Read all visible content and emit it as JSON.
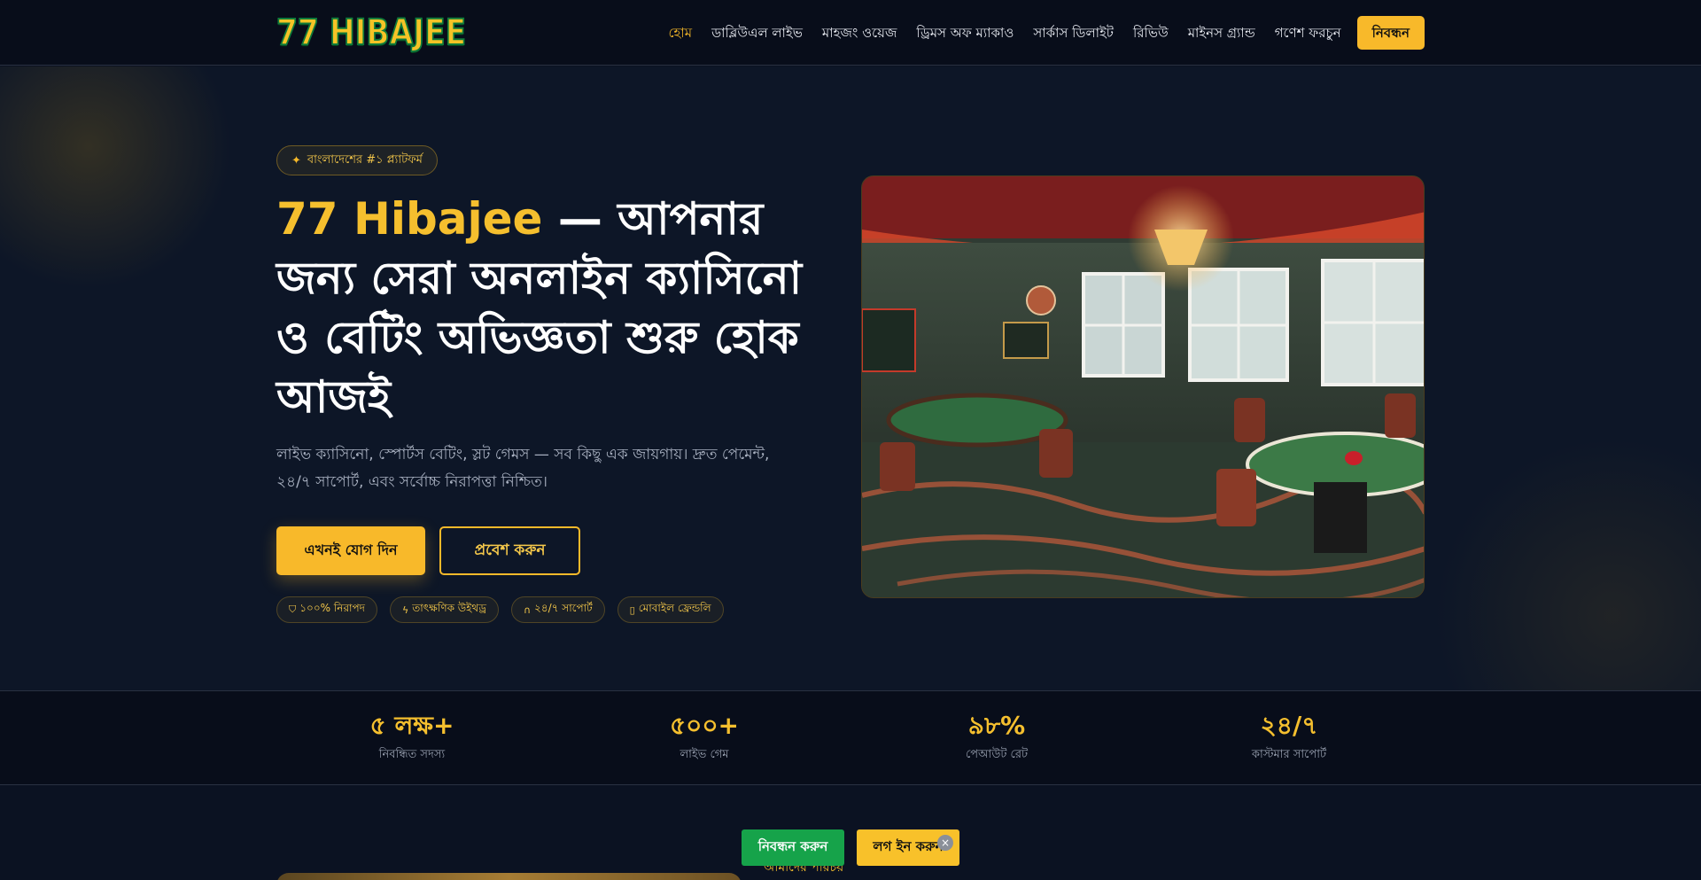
{
  "header": {
    "logo_text": "77 HIBAJEE",
    "nav": [
      {
        "label": "হোম",
        "active": true
      },
      {
        "label": "ডাব্লিউএল লাইভ"
      },
      {
        "label": "মাহজং ওয়েজ"
      },
      {
        "label": "ড্রিমস অফ ম্যাকাও"
      },
      {
        "label": "সার্কাস ডিলাইট"
      },
      {
        "label": "রিভিউ"
      },
      {
        "label": "মাইনস গ্র্যান্ড"
      },
      {
        "label": "গণেশ ফরচুন"
      }
    ],
    "register_label": "নিবন্ধন"
  },
  "hero": {
    "badge_icon": "sparkle-icon",
    "badge_text": "বাংলাদেশের #১ প্ল্যাটফর্ম",
    "headline_brand": "77 Hibajee",
    "headline_rest": " — আপনার জন্য সেরা অনলাইন ক্যাসিনো ও বেটিং অভিজ্ঞতা শুরু হোক আজই",
    "subtext": "লাইভ ক্যাসিনো, স্পোর্টস বেটিং, স্লট গেমস — সব কিছু এক জায়গায়। দ্রুত পেমেন্ট, ২৪/৭ সাপোর্ট, এবং সর্বোচ্চ নিরাপত্তা নিশ্চিত।",
    "primary_button": "এখনই যোগ দিন",
    "secondary_button": "প্রবেশ করুন",
    "features": [
      {
        "icon": "shield-icon",
        "glyph": "⛉",
        "label": "১০০% নিরাপদ"
      },
      {
        "icon": "lightning-icon",
        "glyph": "ϟ",
        "label": "তাৎক্ষণিক উইথড্র"
      },
      {
        "icon": "headset-icon",
        "glyph": "∩",
        "label": "২৪/৭ সাপোর্ট"
      },
      {
        "icon": "mobile-icon",
        "glyph": "▯",
        "label": "মোবাইল ফ্রেন্ডলি"
      }
    ],
    "image_caption": "casino room with poker tables and chandelier"
  },
  "stats": [
    {
      "value": "৫ লক্ষ+",
      "label": "নিবন্ধিত সদস্য"
    },
    {
      "value": "৫০০+",
      "label": "লাইভ গেম"
    },
    {
      "value": "৯৮%",
      "label": "পেআউট রেট"
    },
    {
      "value": "২৪/৭",
      "label": "কাস্টমার সাপোর্ট"
    }
  ],
  "lower": {
    "heading_partial": "আমাদের পরিচয়"
  },
  "sticky": {
    "register_label": "নিবন্ধন করুন",
    "login_label": "লগ ইন করুন",
    "close_glyph": "×"
  },
  "colors": {
    "accent": "#f8b92a",
    "background": "#0d1627",
    "header": "#080d1a",
    "green": "#16a34a"
  }
}
